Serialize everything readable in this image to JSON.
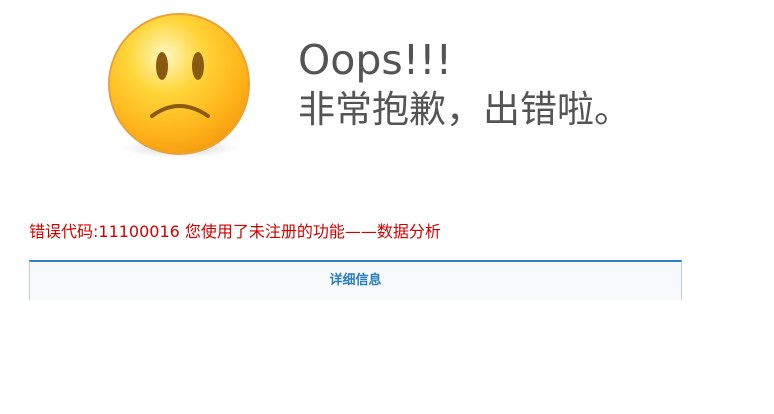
{
  "header": {
    "title": "Oops!!!",
    "subtitle": "非常抱歉，出错啦。"
  },
  "error": {
    "message": "错误代码:11100016 您使用了未注册的功能——数据分析"
  },
  "details": {
    "toggle_label": "详细信息"
  },
  "icons": {
    "face": "sad-face-icon"
  },
  "colors": {
    "heading": "#545454",
    "error_text": "#d40000",
    "link": "#2a7dbf",
    "panel_border": "#2f7fc1",
    "face_yellow": "#ffc21a"
  }
}
